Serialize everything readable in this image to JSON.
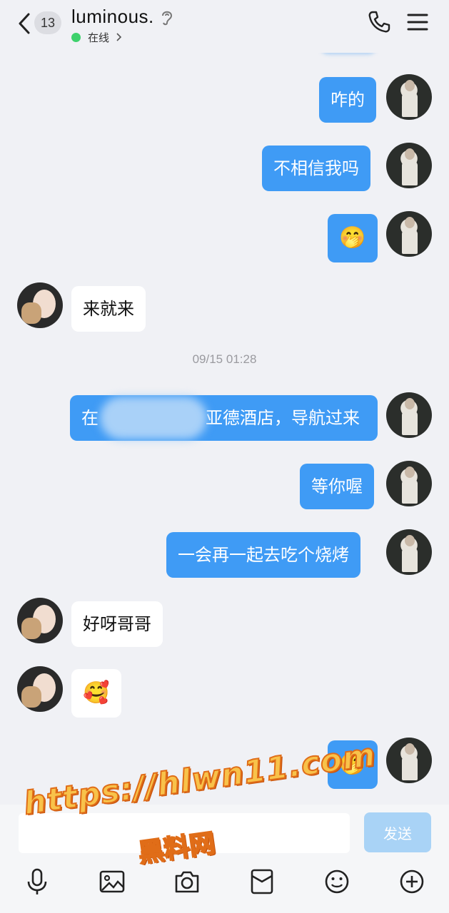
{
  "header": {
    "unread_count": "13",
    "title": "luminous.",
    "status": "在线"
  },
  "messages": [
    {
      "side": "me",
      "text": "咋的"
    },
    {
      "side": "me",
      "text": "不相信我吗"
    },
    {
      "side": "me",
      "text": "🤭"
    },
    {
      "side": "her",
      "text": "来就来"
    },
    {
      "side": "me",
      "text": "在",
      "text_tail": "亚德酒店，导航过来"
    },
    {
      "side": "me",
      "text": "等你喔"
    },
    {
      "side": "me",
      "text": "一会再一起去吃个烧烤"
    },
    {
      "side": "her",
      "text": "好呀哥哥"
    },
    {
      "side": "her",
      "text": "🥰"
    },
    {
      "side": "me",
      "text": "🤭"
    }
  ],
  "timestamp": "09/15 01:28",
  "composer": {
    "send_label": "发送",
    "value": ""
  },
  "toolbar_icons": [
    "microphone-icon",
    "image-icon",
    "camera-icon",
    "red-packet-icon",
    "emoji-icon",
    "plus-icon"
  ],
  "watermark": {
    "line1": "https://hlwn11.com",
    "line2": "黑料网"
  },
  "colors": {
    "my_bubble": "#3f9bf5",
    "her_bubble": "#ffffff",
    "background": "#f0f1f5",
    "online": "#3ed16c",
    "send_button": "#a9d3f6"
  }
}
